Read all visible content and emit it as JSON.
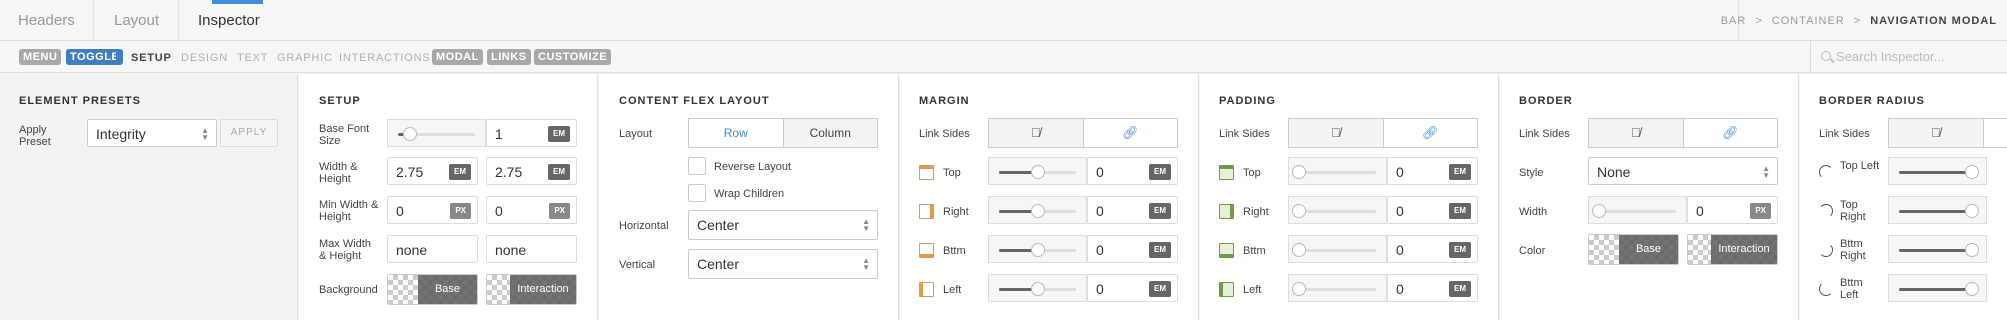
{
  "top_tabs": {
    "headers": "Headers",
    "layout": "Layout",
    "inspector": "Inspector"
  },
  "breadcrumb": [
    "BAR",
    ">",
    "CONTAINER",
    ">",
    "NAVIGATION MODAL"
  ],
  "subnav": {
    "pills": [
      "MENU",
      "TOGGLE"
    ],
    "links": [
      "SETUP",
      "DESIGN",
      "TEXT",
      "GRAPHIC",
      "INTERACTIONS"
    ],
    "pills2": [
      "MODAL",
      "LINKS",
      "CUSTOMIZE"
    ],
    "search_placeholder": "Search Inspector..."
  },
  "element_presets": {
    "title": "ELEMENT PRESETS",
    "apply_label": "Apply Preset",
    "preset_value": "Integrity",
    "apply_button": "APPLY"
  },
  "setup": {
    "title": "SETUP",
    "base_font_size_label": "Base Font Size",
    "base_font_value": "1",
    "base_font_unit": "EM",
    "base_font_level": 0.15,
    "wh_label": "Width & Height",
    "width": "2.75",
    "width_unit": "EM",
    "height": "2.75",
    "height_unit": "EM",
    "min_label": "Min Width & Height",
    "min_width": "0",
    "min_width_unit": "PX",
    "min_height": "0",
    "min_height_unit": "PX",
    "max_label": "Max Width & Height",
    "max_width": "none",
    "max_height": "none",
    "background_label": "Background",
    "base": "Base",
    "interaction": "Interaction"
  },
  "flex": {
    "title": "CONTENT FLEX LAYOUT",
    "layout_label": "Layout",
    "row": "Row",
    "column": "Column",
    "reverse": "Reverse Layout",
    "wrap": "Wrap Children",
    "horizontal_label": "Horizontal",
    "horizontal": "Center",
    "vertical_label": "Vertical",
    "vertical": "Center"
  },
  "margin": {
    "title": "MARGIN",
    "link_sides": "Link Sides",
    "rows": [
      {
        "label": "Top",
        "value": "0",
        "unit": "EM",
        "level": 0.5
      },
      {
        "label": "Right",
        "value": "0",
        "unit": "EM",
        "level": 0.5
      },
      {
        "label": "Bttm",
        "value": "0",
        "unit": "EM",
        "level": 0.5
      },
      {
        "label": "Left",
        "value": "0",
        "unit": "EM",
        "level": 0.5
      }
    ]
  },
  "padding": {
    "title": "PADDING",
    "link_sides": "Link Sides",
    "rows": [
      {
        "label": "Top",
        "value": "0",
        "unit": "EM",
        "level": 0
      },
      {
        "label": "Right",
        "value": "0",
        "unit": "EM",
        "level": 0
      },
      {
        "label": "Bttm",
        "value": "0",
        "unit": "EM",
        "level": 0
      },
      {
        "label": "Left",
        "value": "0",
        "unit": "EM",
        "level": 0
      }
    ]
  },
  "border": {
    "title": "BORDER",
    "link_sides": "Link Sides",
    "style_label": "Style",
    "style": "None",
    "width_label": "Width",
    "width": "0",
    "width_unit": "PX",
    "width_level": 0,
    "color_label": "Color",
    "base": "Base",
    "interaction": "Interaction"
  },
  "border_radius": {
    "title": "BORDER RADIUS",
    "link_sides": "Link Sides",
    "rows": [
      {
        "label": "Top Left",
        "level": 0.95
      },
      {
        "label": "Top Right",
        "level": 0.95
      },
      {
        "label": "Bttm Right",
        "level": 0.95
      },
      {
        "label": "Bttm Left",
        "level": 0.95
      }
    ]
  },
  "colors": {
    "accent": "#3c8fd8",
    "pill": "#a8a8a8",
    "pill_active": "#3f7fbf",
    "margin_icon": "#e39a4b",
    "padding_icon": "#6a9c4a"
  }
}
